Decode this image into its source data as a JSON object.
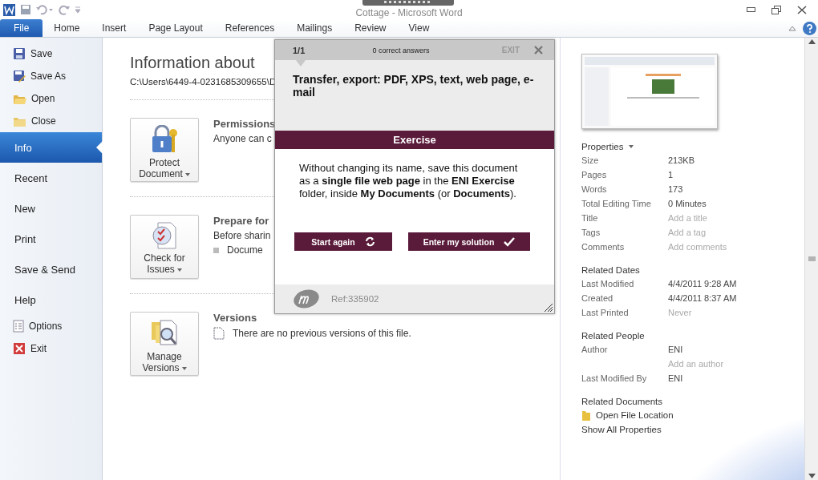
{
  "window": {
    "title": "Cottage - Microsoft Word"
  },
  "ribbon_tabs": [
    {
      "label": "File",
      "selected": true
    },
    {
      "label": "Home",
      "selected": false
    },
    {
      "label": "Insert",
      "selected": false
    },
    {
      "label": "Page Layout",
      "selected": false
    },
    {
      "label": "References",
      "selected": false
    },
    {
      "label": "Mailings",
      "selected": false
    },
    {
      "label": "Review",
      "selected": false
    },
    {
      "label": "View",
      "selected": false
    }
  ],
  "backstage_nav": [
    {
      "kind": "command",
      "label": "Save",
      "selected": false
    },
    {
      "kind": "command",
      "label": "Save As",
      "selected": false
    },
    {
      "kind": "command",
      "label": "Open",
      "selected": false
    },
    {
      "kind": "command",
      "label": "Close",
      "selected": false
    },
    {
      "kind": "page",
      "label": "Info",
      "selected": true
    },
    {
      "kind": "page",
      "label": "Recent",
      "selected": false
    },
    {
      "kind": "page",
      "label": "New",
      "selected": false
    },
    {
      "kind": "page",
      "label": "Print",
      "selected": false
    },
    {
      "kind": "page",
      "label": "Save & Send",
      "selected": false
    },
    {
      "kind": "page",
      "label": "Help",
      "selected": false
    },
    {
      "kind": "command",
      "label": "Options",
      "selected": false
    },
    {
      "kind": "command",
      "label": "Exit",
      "selected": false
    }
  ],
  "info": {
    "heading": "Information about",
    "path": "C:\\Users\\6449-4-0231685309655\\D",
    "sections": [
      {
        "button": "Protect Document",
        "title": "Permissions",
        "lines": [
          {
            "kind": "text",
            "text": "Anyone can c"
          }
        ]
      },
      {
        "button": "Check for Issues",
        "title": "Prepare for",
        "lines": [
          {
            "kind": "text",
            "text": "Before sharin"
          },
          {
            "kind": "bullet",
            "text": "Docume"
          }
        ]
      },
      {
        "button": "Manage Versions",
        "title": "Versions",
        "lines": [
          {
            "kind": "note",
            "text": "There are no previous versions of this file."
          }
        ]
      }
    ]
  },
  "properties": {
    "title": "Properties",
    "rows": [
      {
        "label": "Size",
        "value": "213KB",
        "hint": false
      },
      {
        "label": "Pages",
        "value": "1",
        "hint": false
      },
      {
        "label": "Words",
        "value": "173",
        "hint": false
      },
      {
        "label": "Total Editing Time",
        "value": "0 Minutes",
        "hint": false
      },
      {
        "label": "Title",
        "value": "Add a title",
        "hint": true
      },
      {
        "label": "Tags",
        "value": "Add a tag",
        "hint": true
      },
      {
        "label": "Comments",
        "value": "Add comments",
        "hint": true
      }
    ]
  },
  "related_dates": {
    "title": "Related Dates",
    "rows": [
      {
        "label": "Last Modified",
        "value": "4/4/2011 9:28 AM",
        "hint": false
      },
      {
        "label": "Created",
        "value": "4/4/2011 8:37 AM",
        "hint": false
      },
      {
        "label": "Last Printed",
        "value": "Never",
        "hint": true
      }
    ]
  },
  "related_people": {
    "title": "Related People",
    "rows": [
      {
        "label": "Author",
        "value": "ENI",
        "hint": false
      },
      {
        "value": "Add an author",
        "hint": true
      },
      {
        "label": "Last Modified By",
        "value": "ENI",
        "hint": false
      }
    ]
  },
  "related_documents": {
    "title": "Related Documents",
    "links": [
      {
        "kind": "folder",
        "label": "Open File Location"
      },
      {
        "kind": "plain",
        "label": "Show All Properties"
      }
    ]
  },
  "exercise": {
    "counter": "1/1",
    "score": "0 correct answers",
    "exit": "EXIT",
    "topic": "Transfer, export: PDF, XPS, text, web page, e-mail",
    "band": "Exercise",
    "instructions": "Without changing its name, save this document as a **single file web page** in the **ENI Exercise** folder, inside **My Documents** (or **Documents**).",
    "buttons": [
      {
        "kind": "restart",
        "label": "Start again"
      },
      {
        "kind": "submit",
        "label": "Enter my solution"
      }
    ],
    "ref": "Ref:335902"
  }
}
